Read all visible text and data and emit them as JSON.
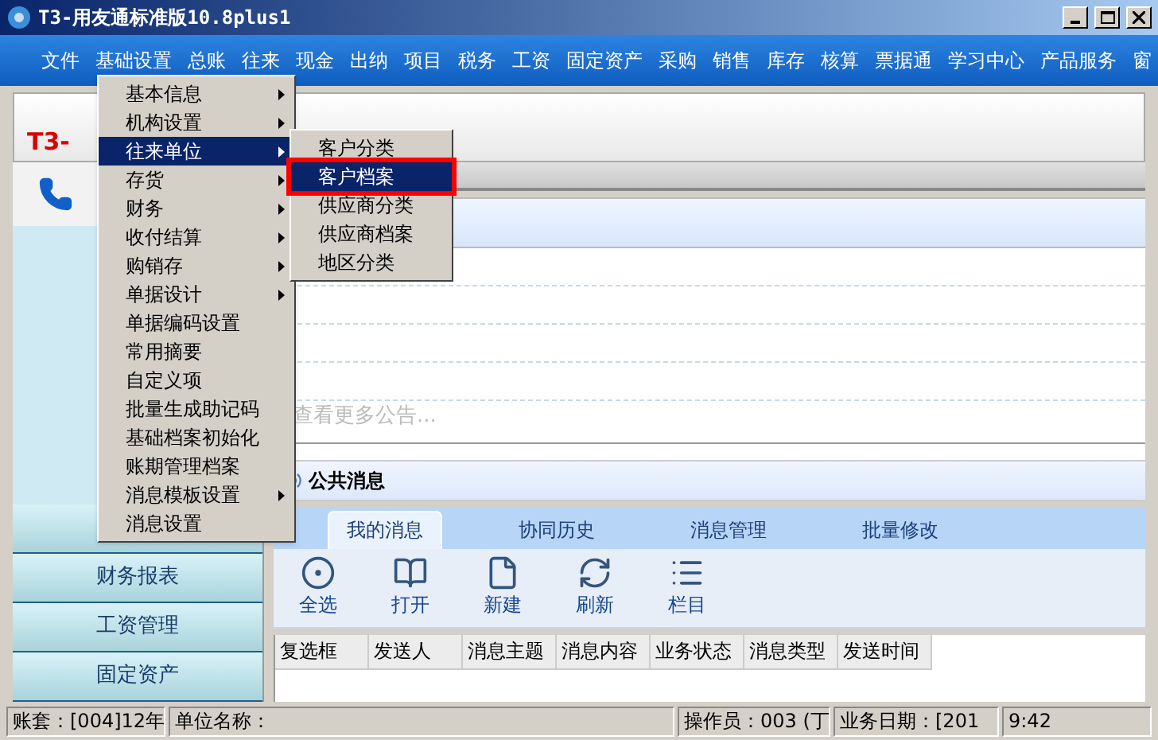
{
  "window": {
    "title": "T3-用友通标准版10.8plus1"
  },
  "menu_bar": [
    "文件",
    "基础设置",
    "总账",
    "往来",
    "现金",
    "出纳",
    "项目",
    "税务",
    "工资",
    "固定资产",
    "采购",
    "销售",
    "库存",
    "核算",
    "票据通",
    "学习中心",
    "产品服务",
    "窗"
  ],
  "open_menu": {
    "items": [
      {
        "label": "基本信息",
        "has_submenu": true,
        "selected": false
      },
      {
        "label": "机构设置",
        "has_submenu": true,
        "selected": false
      },
      {
        "label": "往来单位",
        "has_submenu": true,
        "selected": true
      },
      {
        "label": "存货",
        "has_submenu": true,
        "selected": false
      },
      {
        "label": "财务",
        "has_submenu": true,
        "selected": false
      },
      {
        "label": "收付结算",
        "has_submenu": true,
        "selected": false
      },
      {
        "label": "购销存",
        "has_submenu": true,
        "selected": false
      },
      {
        "label": "单据设计",
        "has_submenu": true,
        "selected": false
      },
      {
        "label": "单据编码设置",
        "has_submenu": false,
        "selected": false
      },
      {
        "label": "常用摘要",
        "has_submenu": false,
        "selected": false
      },
      {
        "label": "自定义项",
        "has_submenu": false,
        "selected": false
      },
      {
        "label": "批量生成助记码",
        "has_submenu": false,
        "selected": false
      },
      {
        "label": "基础档案初始化",
        "has_submenu": false,
        "selected": false
      },
      {
        "label": "账期管理档案",
        "has_submenu": false,
        "selected": false
      },
      {
        "label": "消息模板设置",
        "has_submenu": true,
        "selected": false
      },
      {
        "label": "消息设置",
        "has_submenu": false,
        "selected": false
      }
    ]
  },
  "submenu": {
    "items": [
      {
        "label": "客户分类",
        "selected": false,
        "outlined": false
      },
      {
        "label": "客户档案",
        "selected": true,
        "outlined": true
      },
      {
        "label": "供应商分类",
        "selected": false,
        "outlined": false
      },
      {
        "label": "供应商档案",
        "selected": false,
        "outlined": false
      },
      {
        "label": "地区分类",
        "selected": false,
        "outlined": false
      }
    ]
  },
  "logo": "T3-",
  "sidebar": {
    "items": [
      "财务报表",
      "工资管理",
      "固定资产"
    ]
  },
  "notices": {
    "more_link": "查看更多公告..."
  },
  "messages": {
    "title": "公共消息",
    "tabs": [
      {
        "label": "我的消息",
        "selected": true
      },
      {
        "label": "协同历史",
        "selected": false
      },
      {
        "label": "消息管理",
        "selected": false
      },
      {
        "label": "批量修改",
        "selected": false
      }
    ],
    "toolbar": [
      {
        "label": "全选",
        "kind": "select_all"
      },
      {
        "label": "打开",
        "kind": "open"
      },
      {
        "label": "新建",
        "kind": "new"
      },
      {
        "label": "刷新",
        "kind": "refresh"
      },
      {
        "label": "栏目",
        "kind": "columns"
      }
    ],
    "columns": [
      "复选框",
      "发送人",
      "消息主题",
      "消息内容",
      "业务状态",
      "消息类型",
      "发送时间"
    ]
  },
  "status_bar": [
    "账套：[004]12年",
    "单位名称：",
    "操作员：003 (丁",
    "业务日期：[201",
    "9:42"
  ]
}
